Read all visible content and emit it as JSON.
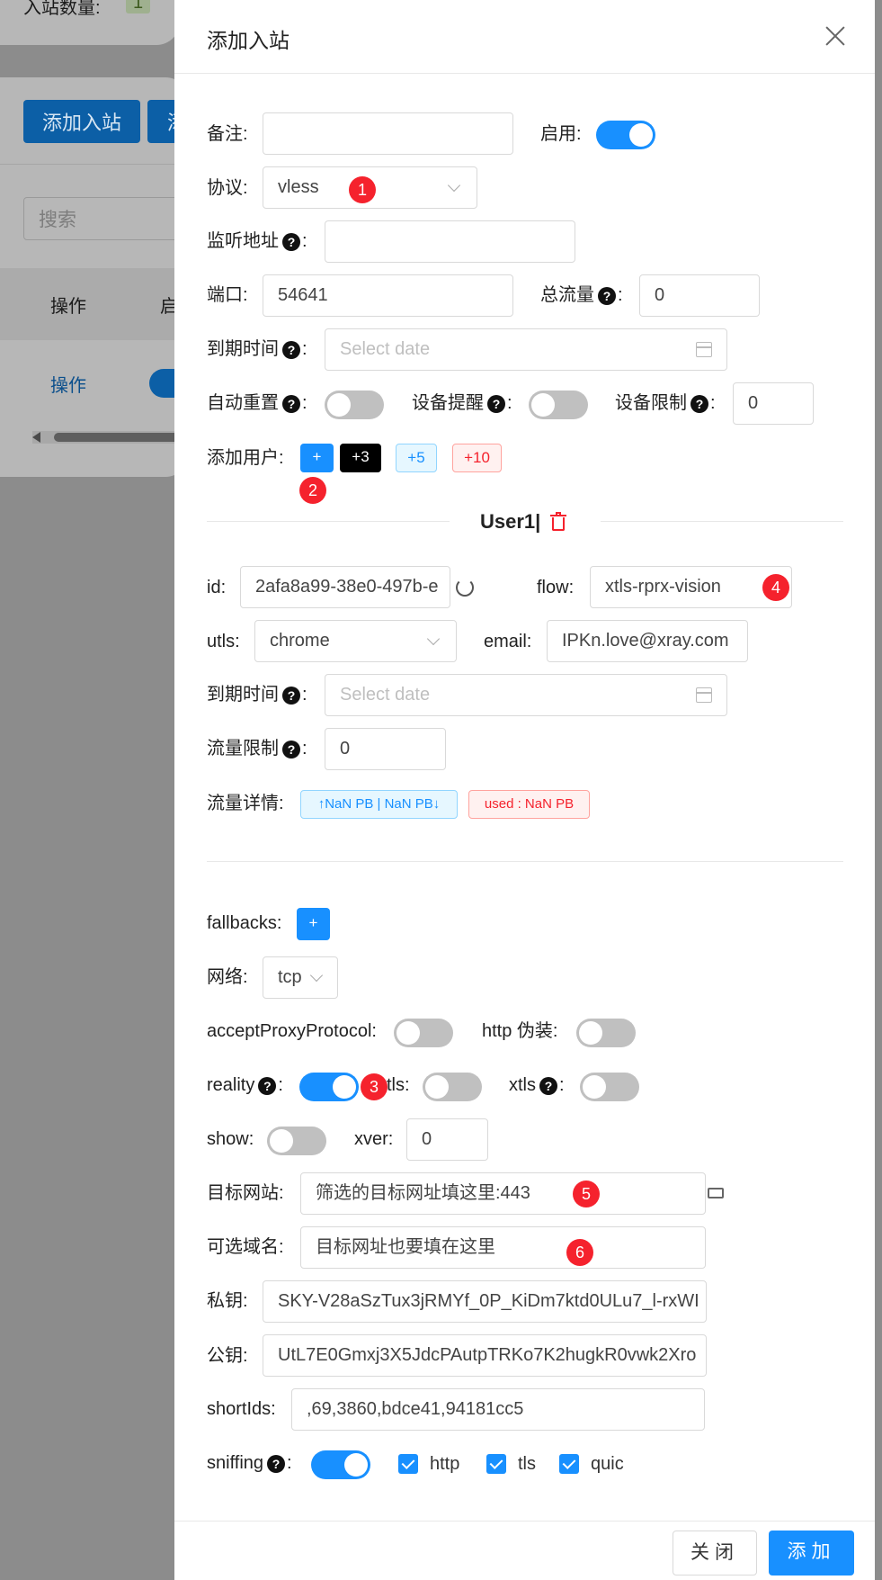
{
  "background": {
    "inbound_count_label": "入站数量:",
    "inbound_count": "1",
    "add_inbound_button": "添加入站",
    "second_button": "添",
    "search_placeholder": "搜索",
    "col_action": "操作",
    "col_enable": "启",
    "row_action": "操作"
  },
  "modal": {
    "title": "添加入站",
    "remark_label": "备注:",
    "enable_label": "启用:",
    "protocol_label": "协议:",
    "protocol_value": "vless",
    "listen_label": "监听地址",
    "port_label": "端口:",
    "port_value": "54641",
    "total_traffic_label": "总流量",
    "total_traffic_value": "0",
    "expiry_label": "到期时间",
    "date_placeholder": "Select date",
    "auto_reset_label": "自动重置",
    "device_alert_label": "设备提醒",
    "device_limit_label": "设备限制",
    "device_limit_value": "0",
    "add_user_label": "添加用户:",
    "add_user_plus": "+",
    "add_user_3": "+3",
    "add_user_5": "+5",
    "add_user_10": "+10",
    "user_title": "User1|",
    "id_label": "id:",
    "id_value": "2afa8a99-38e0-497b-e",
    "flow_label": "flow:",
    "flow_value": "xtls-rprx-vision",
    "utls_label": "utls:",
    "utls_value": "chrome",
    "email_label": "email:",
    "email_value": "IPKn.love@xray.com",
    "user_expiry_label": "到期时间",
    "traffic_limit_label": "流量限制",
    "traffic_limit_value": "0",
    "traffic_detail_label": "流量详情:",
    "traffic_up_down": "↑NaN PB | NaN PB↓",
    "traffic_used": "used : NaN PB",
    "fallbacks_label": "fallbacks:",
    "fallbacks_plus": "+",
    "network_label": "网络:",
    "network_value": "tcp",
    "accept_proxy_label": "acceptProxyProtocol:",
    "http_camouflage_label": "http 伪装:",
    "reality_label": "reality",
    "tls_label": "tls:",
    "xtls_label": "xtls",
    "show_label": "show:",
    "xver_label": "xver:",
    "xver_value": "0",
    "target_site_label": "目标网站:",
    "target_site_value": "筛选的目标网址填这里:443",
    "server_names_label": "可选域名:",
    "server_names_value": "目标网址也要填在这里",
    "private_key_label": "私钥:",
    "private_key_value": "SKY-V28aSzTux3jRMYf_0P_KiDm7ktd0ULu7_l-rxWI",
    "public_key_label": "公钥:",
    "public_key_value": "UtL7E0Gmxj3X5JdcPAutpTRKo7K2hugkR0vwk2Xro",
    "short_ids_label": "shortIds:",
    "short_ids_value": ",69,3860,bdce41,94181cc5",
    "sniffing_label": "sniffing",
    "sniff_http": "http",
    "sniff_tls": "tls",
    "sniff_quic": "quic",
    "close_button": "关闭",
    "add_button": "添加"
  },
  "annotations": [
    "1",
    "2",
    "3",
    "4",
    "5",
    "6"
  ],
  "colors": {
    "primary": "#1890ff",
    "badge": "#f5222d",
    "switch_off": "#c0c0c0"
  }
}
